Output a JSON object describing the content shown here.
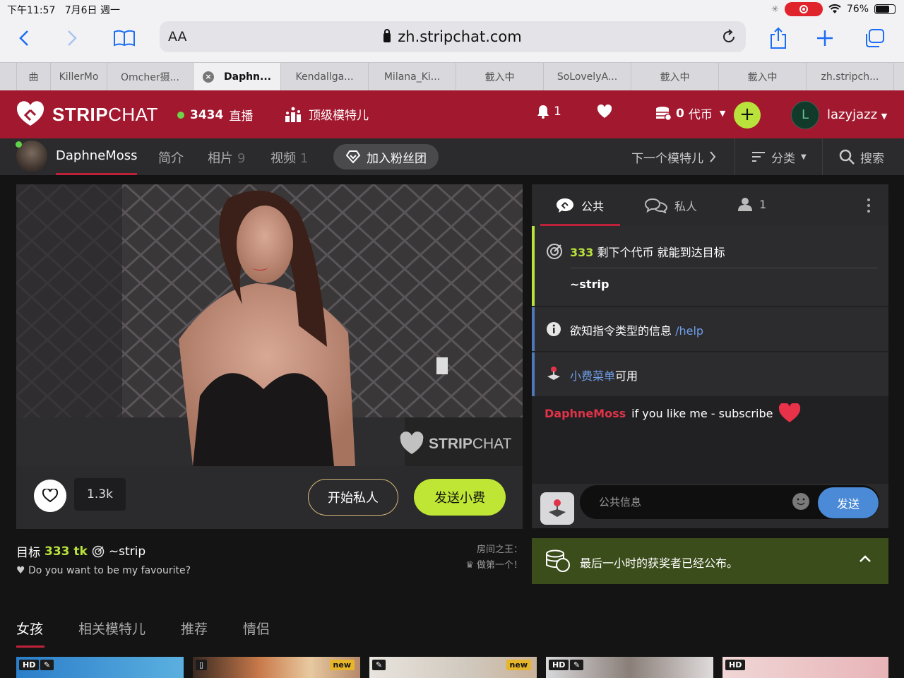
{
  "status_bar": {
    "time": "下午11:57",
    "date": "7月6日 週一",
    "battery": "76%",
    "battery_level": 0.76
  },
  "browser": {
    "text_size_label": "AA",
    "url": "zh.stripchat.com",
    "tabs": [
      {
        "label": "曲",
        "active": false
      },
      {
        "label": "KillerMo",
        "active": false
      },
      {
        "label": "Omcher摄...",
        "active": false
      },
      {
        "label": "Daphn...",
        "active": true
      },
      {
        "label": "Kendallga...",
        "active": false
      },
      {
        "label": "Milana_Ki...",
        "active": false
      },
      {
        "label": "載入中",
        "active": false
      },
      {
        "label": "SoLovelyA...",
        "active": false
      },
      {
        "label": "載入中",
        "active": false
      },
      {
        "label": "載入中",
        "active": false
      },
      {
        "label": "zh.stripch...",
        "active": false
      }
    ]
  },
  "header": {
    "logo_strip": "STRIP",
    "logo_chat": "CHAT",
    "live_count": "3434",
    "live_label": "直播",
    "top_models": "顶级模特儿",
    "notifications": "1",
    "tokens": "0",
    "tokens_label": "代币",
    "add_label": "+",
    "avatar_letter": "L",
    "username": "lazyjazz"
  },
  "model_nav": {
    "model_name": "DaphneMoss",
    "profile": "简介",
    "photos": "相片",
    "photos_count": "9",
    "videos": "视频",
    "videos_count": "1",
    "fanclub": "加入粉丝团",
    "next_model": "下一个模特儿",
    "categories": "分类",
    "search": "搜索"
  },
  "video": {
    "watermark_strip": "STRIP",
    "watermark_chat": "CHAT",
    "likes": "1.3k",
    "start_private": "开始私人",
    "send_tip": "发送小费"
  },
  "goal": {
    "prefix": "目标",
    "amount": "333 tk",
    "name": "~strip",
    "tagline": "♥ Do you want to be my favourite?",
    "king_line1": "房间之王：",
    "king_line2": "做第一个！"
  },
  "chat": {
    "tab_public": "公共",
    "tab_private": "私人",
    "tab_users": "1",
    "goal_tokens": "333",
    "goal_text": "剩下个代币 就能到达目标",
    "goal_name": "~strip",
    "info_text": "欲知指令类型的信息",
    "info_link": "/help",
    "menu_link": "小费菜单",
    "menu_text": "可用",
    "message_user": "DaphneMoss",
    "message_text": "if you like me - subscribe",
    "input_placeholder": "公共信息",
    "send": "发送",
    "winner_text": "最后一小时的获奖者已经公布。"
  },
  "bottom_tabs": [
    "女孩",
    "相关模特儿",
    "推荐",
    "情侣"
  ],
  "thumbnails": [
    {
      "badges": [
        "HD",
        "edit"
      ]
    },
    {
      "badges": [
        "phone",
        "new"
      ]
    },
    {
      "badges": [
        "edit",
        "new"
      ]
    },
    {
      "badges": [
        "HD",
        "edit"
      ]
    },
    {
      "badges": [
        "HD"
      ]
    }
  ],
  "colors": {
    "brand_red": "#a2182f",
    "accent_green": "#bfe634",
    "link_blue": "#6f9ee8",
    "send_blue": "#4b8ad6"
  }
}
